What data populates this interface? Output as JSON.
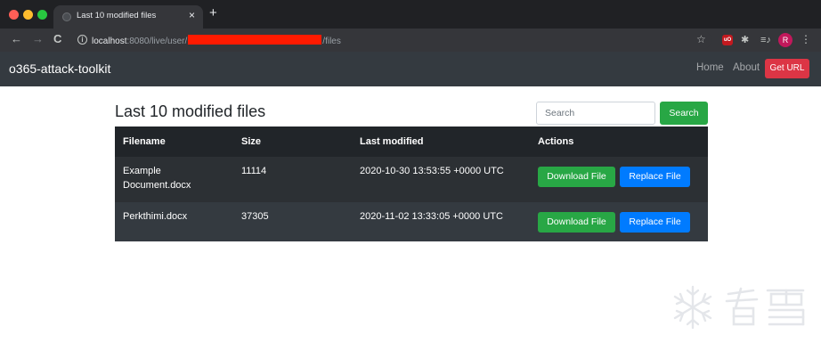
{
  "browser": {
    "tab_title": "Last 10 modified files",
    "tab_close": "×",
    "new_tab": "+",
    "url_host": "localhost",
    "url_port_path": ":8080/live/user/",
    "url_suffix": "/files",
    "back": "←",
    "forward": "→",
    "reload": "C",
    "star": "☆",
    "ublock": "uO",
    "puzzle": "✱",
    "queue": "≡♪",
    "avatar_initial": "R",
    "kebab": "⋮"
  },
  "navbar": {
    "brand": "o365-attack-toolkit",
    "links": [
      "Home",
      "About"
    ],
    "cta": "Get URL"
  },
  "main": {
    "title": "Last 10 modified files",
    "search_placeholder": "Search",
    "search_button": "Search",
    "table": {
      "headers": [
        "Filename",
        "Size",
        "Last modified",
        "Actions"
      ],
      "rows": [
        {
          "filename": "Example Document.docx",
          "size": "11114",
          "modified": "2020-10-30 13:53:55 +0000 UTC",
          "download": "Download File",
          "replace": "Replace File"
        },
        {
          "filename": "Perkthimi.docx",
          "size": "37305",
          "modified": "2020-11-02 13:33:05 +0000 UTC",
          "download": "Download File",
          "replace": "Replace File"
        }
      ]
    }
  },
  "colors": {
    "navbar_bg": "#343a40",
    "success": "#28a745",
    "primary": "#007bff",
    "danger": "#dc3545",
    "redaction": "#ff1a00"
  }
}
